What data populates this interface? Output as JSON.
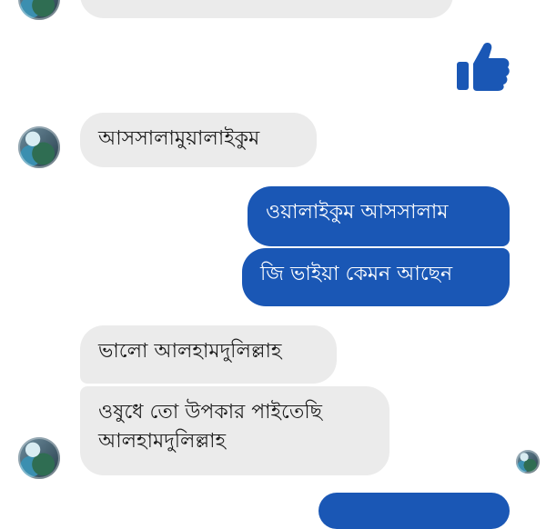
{
  "conversation": {
    "messages": [
      {
        "side": "in",
        "text": "আসসালামুয়ালাইকুম"
      },
      {
        "side": "out",
        "text": "ওয়ালাইকুম আসসালাম"
      },
      {
        "side": "out",
        "text": "জি ভাইয়া কেমন আছেন"
      },
      {
        "side": "in",
        "text": "ভালো আলহামদুলিল্লাহ"
      },
      {
        "side": "in",
        "lines": [
          "ওষুধে তো উপকার পাইতেছি",
          "আলহামদুলিল্লাহ"
        ]
      }
    ]
  },
  "colors": {
    "outgoing_bubble": "#1a57b5",
    "incoming_bubble": "#ebebeb",
    "like_icon": "#1a57b5"
  },
  "icons": {
    "like": "thumbs-up-icon",
    "avatar": "contact-avatar"
  }
}
